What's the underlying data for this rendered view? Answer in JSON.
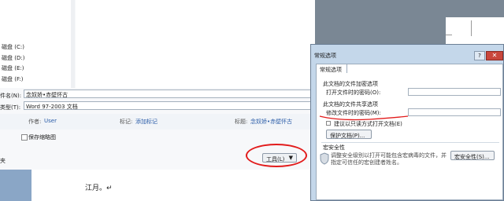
{
  "save_dialog": {
    "drives": [
      "磁盘 (C:)",
      "磁盘 (D:)",
      "磁盘 (E:)",
      "磁盘 (F:)"
    ],
    "filename_label": "件名(N):",
    "filename_value": "念奴娇•赤壁怀古",
    "filetype_label": "类型(T):",
    "filetype_value": "Word 97-2003 文档",
    "author_label": "作者:",
    "author_value": "User",
    "tags_label": "标记:",
    "tags_value": "添加标记",
    "title_label": "标题:",
    "title_value": "念奴娇•赤壁怀古",
    "thumbnail_label": "保存缩略图",
    "hide_folders_label": "夹",
    "tools_label": "工具(L)",
    "tools_arrow": "▼"
  },
  "document": {
    "body_text": "江月。↵"
  },
  "general_options": {
    "title": "常规选项",
    "help_symbol": "?",
    "close_symbol": "✕",
    "tab_label": "常规选项",
    "open_group_title": "此文档的文件加密选项",
    "open_password_label": "打开文件时的密码(O):",
    "modify_group_title": "此文档的文件共享选项",
    "modify_password_label": "修改文件时的密码(M):",
    "readonly_label": "建议以只读方式打开文档(E)",
    "protect_button_label": "保护文档(P)...",
    "macro_group_title": "宏安全性",
    "macro_description_line1": "调整安全级别以打开可能包含宏病毒的文件，并",
    "macro_description_line2": "指定可信任的宏创建者姓名。",
    "macro_button_label": "宏安全性(S)..."
  },
  "colors": {
    "annotation_red": "#e21b1b",
    "link_blue": "#2a5ca8",
    "dialog_frame": "#c4d7ea"
  }
}
